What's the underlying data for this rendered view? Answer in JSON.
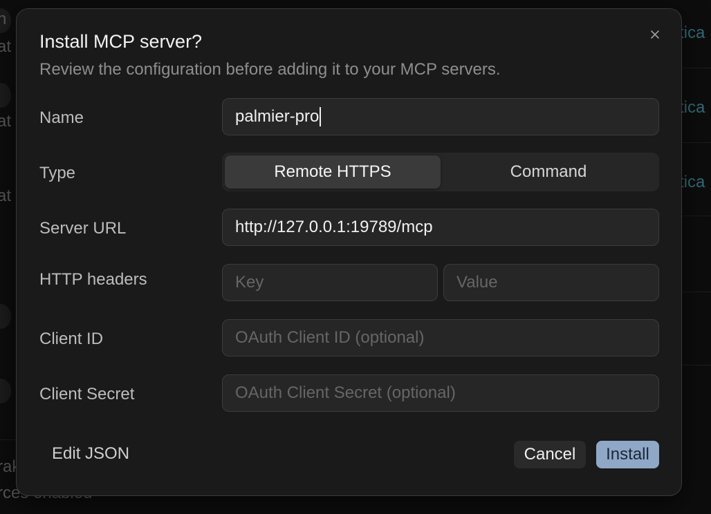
{
  "background": {
    "fragments": [
      {
        "id": "frag-1",
        "text": "n"
      },
      {
        "id": "frag-2",
        "text": "at"
      },
      {
        "id": "frag-3",
        "text": "at"
      },
      {
        "id": "frag-4",
        "text": "at"
      },
      {
        "id": "frag-5",
        "text": "rak"
      },
      {
        "id": "frag-6",
        "text": "rces enabled"
      }
    ],
    "teal_fragments": [
      {
        "id": "teal-1",
        "text": "tica"
      },
      {
        "id": "teal-2",
        "text": "tica"
      },
      {
        "id": "teal-3",
        "text": "tica"
      }
    ]
  },
  "modal": {
    "title": "Install MCP server?",
    "subtitle": "Review the configuration before adding it to your MCP servers.",
    "close_icon": "close-icon",
    "fields": {
      "name": {
        "label": "Name",
        "value": "palmier-pro"
      },
      "type": {
        "label": "Type",
        "options": [
          "Remote HTTPS",
          "Command"
        ],
        "selected": "Remote HTTPS"
      },
      "server_url": {
        "label": "Server URL",
        "value": "http://127.0.0.1:19789/mcp"
      },
      "http_headers": {
        "label": "HTTP headers",
        "key_placeholder": "Key",
        "value_placeholder": "Value"
      },
      "client_id": {
        "label": "Client ID",
        "placeholder": "OAuth Client ID (optional)"
      },
      "client_secret": {
        "label": "Client Secret",
        "placeholder": "OAuth Client Secret (optional)"
      }
    },
    "footer": {
      "edit_json": "Edit JSON",
      "cancel": "Cancel",
      "install": "Install"
    }
  },
  "colors": {
    "accent_install": "#8fa8c8",
    "modal_bg": "#1a1a1a",
    "field_bg": "#262626"
  }
}
